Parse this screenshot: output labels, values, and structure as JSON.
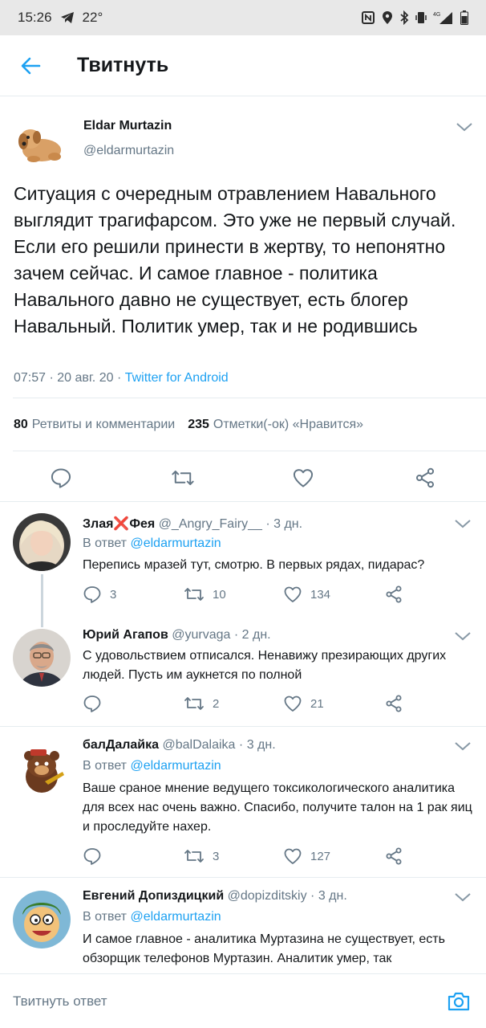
{
  "status_bar": {
    "time": "15:26",
    "temperature": "22°",
    "network": "4G"
  },
  "app_bar": {
    "title": "Твитнуть",
    "back_icon": "arrow-left-icon"
  },
  "main_tweet": {
    "name": "Eldar Murtazin",
    "handle": "@eldarmurtazin",
    "text": "Ситуация с очередным отравлением Навального выглядит трагифарсом. Это уже не первый случай. Если его решили принести в жертву,  то непонятно зачем сейчас. И самое главное - политика Навального давно не существует,  есть блогер Навальный. Политик умер,  так и не родившись",
    "time": "07:57",
    "date": "20 авг. 20",
    "source": "Twitter for Android",
    "retweets_count": "80",
    "retweets_label": "Ретвиты и комментарии",
    "likes_count": "235",
    "likes_label": "Отметки(-ок) «Нравится»"
  },
  "replies": [
    {
      "name": "Злая",
      "name_emoji": "❌",
      "name_suffix": "Фея",
      "handle": "@_Angry_Fairy__",
      "age": "3 дн.",
      "reply_prefix": "В ответ",
      "reply_to": "@eldarmurtazin",
      "text": "Перепись мразей тут, смотрю. В первых рядах, пидарас?",
      "replies": "3",
      "retweets": "10",
      "likes": "134"
    },
    {
      "name": "Юрий Агапов",
      "handle": "@yurvaga",
      "age": "2 дн.",
      "text": "С удовольствием отписался. Ненавижу презирающих других людей. Пусть им аукнется по полной",
      "replies": "",
      "retweets": "2",
      "likes": "21"
    },
    {
      "name": "балДалайка",
      "handle": "@balDalaika",
      "age": "3 дн.",
      "reply_prefix": "В ответ",
      "reply_to": "@eldarmurtazin",
      "text": "Ваше сраное мнение ведущего токсикологического аналитика для всех нас очень важно. Спасибо, получите талон на 1 рак яиц и проследуйте нахер.",
      "replies": "",
      "retweets": "3",
      "likes": "127"
    },
    {
      "name": "Евгений Допиздицкий",
      "handle": "@dopizditskiy",
      "age": "3 дн.",
      "reply_prefix": "В ответ",
      "reply_to": "@eldarmurtazin",
      "text": "И самое главное - аналитика Муртазина не существует, есть обзорщик телефонов Муртазин. Аналитик умер, так"
    }
  ],
  "composer": {
    "placeholder": "Твитнуть ответ"
  },
  "colors": {
    "accent": "#1da1f2",
    "secondary_text": "#657786",
    "primary_text": "#14171a",
    "status_bar": "#e8e8e8"
  }
}
